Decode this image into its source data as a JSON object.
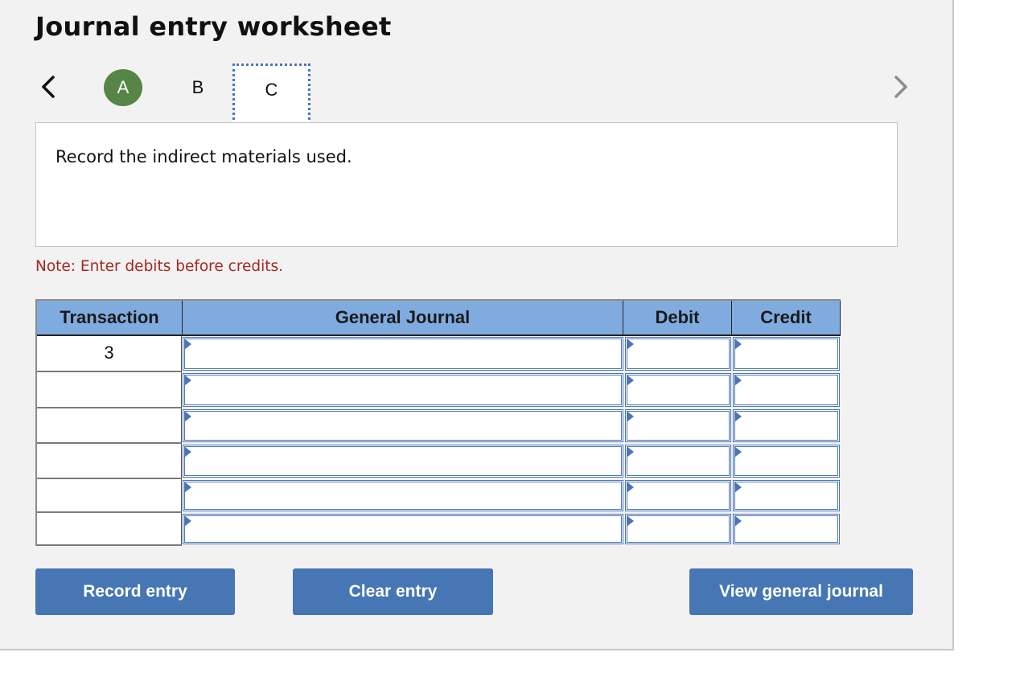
{
  "header": {
    "title": "Journal entry worksheet"
  },
  "nav": {
    "prev_icon": "chevron-left-icon",
    "next_icon": "chevron-right-icon",
    "steps": [
      {
        "label": "A",
        "state": "completed"
      },
      {
        "label": "B",
        "state": "default"
      },
      {
        "label": "C",
        "state": "active"
      }
    ]
  },
  "prompt": {
    "text": "Record the indirect materials used."
  },
  "note": {
    "text": "Note: Enter debits before credits."
  },
  "journal": {
    "columns": [
      "Transaction",
      "General Journal",
      "Debit",
      "Credit"
    ],
    "rows": [
      {
        "transaction": "3",
        "account": "",
        "debit": "",
        "credit": ""
      },
      {
        "transaction": "",
        "account": "",
        "debit": "",
        "credit": ""
      },
      {
        "transaction": "",
        "account": "",
        "debit": "",
        "credit": ""
      },
      {
        "transaction": "",
        "account": "",
        "debit": "",
        "credit": ""
      },
      {
        "transaction": "",
        "account": "",
        "debit": "",
        "credit": ""
      },
      {
        "transaction": "",
        "account": "",
        "debit": "",
        "credit": ""
      }
    ]
  },
  "buttons": {
    "record": "Record entry",
    "clear": "Clear entry",
    "view": "View general journal"
  },
  "colors": {
    "completed_step": "#578447",
    "header_bg": "#80abdf",
    "button_bg": "#4676b4",
    "note_text": "#a6271f",
    "active_outline": "#4a76b8"
  }
}
